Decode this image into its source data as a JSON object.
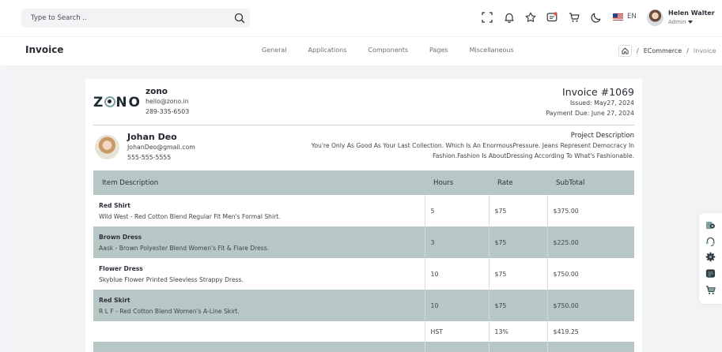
{
  "header": {
    "search_placeholder": "Type to Search ..",
    "language": "EN",
    "user": {
      "name": "Helen Walter",
      "role": "Admin"
    },
    "icons": [
      "search-icon",
      "fullscreen-icon",
      "bell-icon",
      "star-icon",
      "message-icon",
      "cart-icon",
      "moon-icon",
      "flag-us-icon"
    ],
    "notification_dot_color": "#d9534f"
  },
  "subheader": {
    "title": "Invoice",
    "nav": [
      "General",
      "Applications",
      "Components",
      "Pages",
      "Miscellaneous"
    ],
    "breadcrumb": {
      "link": "ECommerce",
      "current": "Invoice"
    }
  },
  "invoice": {
    "company": {
      "logo_text": "ZONO",
      "name": "zono",
      "email": "hello@zono.in",
      "phone": "289-335-6503"
    },
    "number": "Invoice #1069",
    "issued": "Issued: May27, 2024",
    "due": "Payment Due: June 27, 2024",
    "customer": {
      "name": "Johan Deo",
      "email": "JohanDeo@gmail.com",
      "phone": "555-555-5555"
    },
    "project": {
      "title": "Project Description",
      "description": "You're Only As Good As Your Last Collection. Which Is An EnormousPressure. Jeans Represent Democracy In Fashion.Fashion Is AboutDressing According To What's Fashionable."
    },
    "table": {
      "headers": [
        "Item Description",
        "Hours",
        "Rate",
        "SubTotal"
      ],
      "rows": [
        {
          "title": "Red Shirt",
          "desc": "Wild West - Red Cotton Blend Regular Fit Men's Formal Shirt.",
          "hours": "5",
          "rate": "$75",
          "subtotal": "$375.00"
        },
        {
          "title": "Brown Dress",
          "desc": "Aask - Brown Polyester Blend Women's Fit & Flare Dress.",
          "hours": "3",
          "rate": "$75",
          "subtotal": "$225.00"
        },
        {
          "title": "Flower Dress",
          "desc": "Skyblue Flower Printed Sleevless Strappy Dress.",
          "hours": "10",
          "rate": "$75",
          "subtotal": "$750.00"
        },
        {
          "title": "Red Skirt",
          "desc": "R L F - Red Cotton Blend Women's A-Line Skirt.",
          "hours": "10",
          "rate": "$75",
          "subtotal": "$750.00"
        }
      ],
      "tax": {
        "label": "HST",
        "rate": "13%",
        "amount": "$419.25"
      }
    }
  },
  "floating_tools": [
    "customizer-icon",
    "support-icon",
    "settings-icon",
    "layout-icon",
    "cart-icon"
  ],
  "colors": {
    "accent": "#7fa2a0",
    "table_band": "#b6c7c6",
    "background": "#f4f5f8"
  }
}
